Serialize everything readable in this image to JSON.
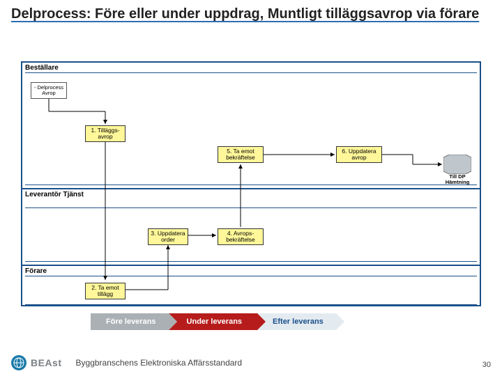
{
  "title": "Delprocess: Före eller under uppdrag, Muntligt tilläggsavrop via förare",
  "lanes": {
    "bestallare": "Beställare",
    "leverantor": "Leverantör Tjänst",
    "forare": "Förare"
  },
  "nodes": {
    "start": "- Delprocess Avrop",
    "n1": "1. Tilläggs­avrop",
    "n2": "2. Ta emot tillägg",
    "n3": "3. Uppdatera order",
    "n4": "4. Avrops­bekräftelse",
    "n5": "5. Ta emot bekräftelse",
    "n6": "6. Uppdatera avrop",
    "end": "Till DP Hämtning"
  },
  "ribbons": {
    "r1": "Före leverans",
    "r2": "Under leverans",
    "r3": "Efter leverans"
  },
  "footer": {
    "brand": "BEAst",
    "tagline": "Byggbranschens Elektroniska Affärsstandard",
    "page": "30"
  }
}
